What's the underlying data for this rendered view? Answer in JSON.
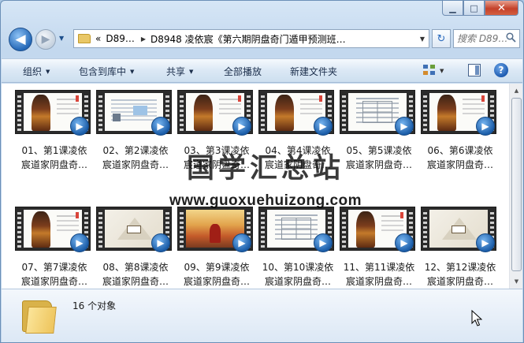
{
  "window": {
    "controls": {
      "minimize": "▁",
      "maximize": "□",
      "close": "✕"
    }
  },
  "nav": {
    "back": "◀",
    "forward": "▶",
    "history": "▼",
    "address": {
      "overflow": "«",
      "segments": [
        "D89…",
        "D8948 凌依宸《第六期阴盘奇门遁甲预测班…"
      ],
      "dropdown": "▼"
    },
    "refresh": "↻",
    "search": {
      "placeholder": "搜索 D89…",
      "icon": "🔍"
    }
  },
  "toolbar": {
    "organize": "组织",
    "include_library": "包含到库中",
    "share": "共享",
    "play_all": "全部播放",
    "new_folder": "新建文件夹",
    "arrow": "▼",
    "help": "?"
  },
  "files": [
    {
      "line1": "01、第1课凌依",
      "line2": "宸道家阴盘奇…",
      "thumb": "portrait"
    },
    {
      "line1": "02、第2课凌依",
      "line2": "宸道家阴盘奇…",
      "thumb": "doc"
    },
    {
      "line1": "03、第3课凌依",
      "line2": "宸道家阴盘奇…",
      "thumb": "portrait"
    },
    {
      "line1": "04、第4课凌依",
      "line2": "宸道家阴盘奇…",
      "thumb": "portrait"
    },
    {
      "line1": "05、第5课凌依",
      "line2": "宸道家阴盘奇…",
      "thumb": "table"
    },
    {
      "line1": "06、第6课凌依",
      "line2": "宸道家阴盘奇…",
      "thumb": "portrait"
    },
    {
      "line1": "07、第7课凌依",
      "line2": "宸道家阴盘奇…",
      "thumb": "portrait"
    },
    {
      "line1": "08、第8课凌依",
      "line2": "宸道家阴盘奇…",
      "thumb": "diagram"
    },
    {
      "line1": "09、第9课凌依",
      "line2": "宸道家阴盘奇…",
      "thumb": "stage"
    },
    {
      "line1": "10、第10课凌依",
      "line2": "宸道家阴盘奇…",
      "thumb": "table"
    },
    {
      "line1": "11、第11课凌依",
      "line2": "宸道家阴盘奇…",
      "thumb": "portrait"
    },
    {
      "line1": "12、第12课凌依",
      "line2": "宸道家阴盘奇…",
      "thumb": "diagram"
    }
  ],
  "media_icon": "▶",
  "watermark": {
    "title": "国学汇总站",
    "url": "www.guoxuehuizong.com"
  },
  "scrollbar": {
    "up": "▲",
    "down": "▼"
  },
  "details": {
    "count": "16 个对象"
  }
}
